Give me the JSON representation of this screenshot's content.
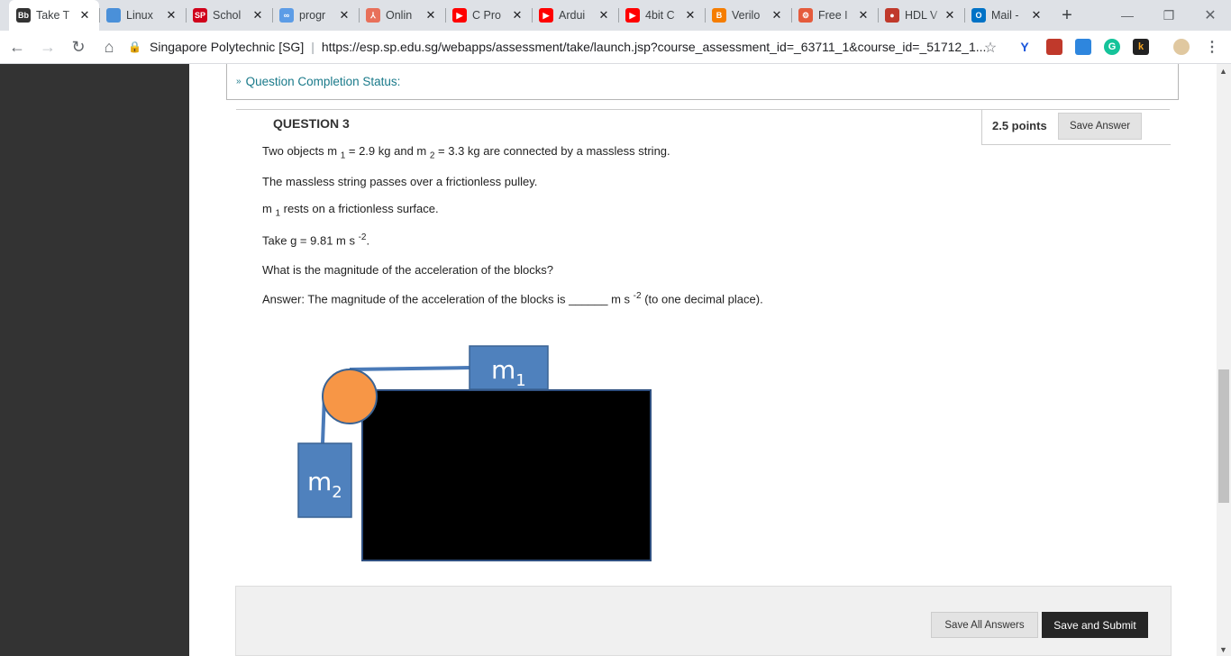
{
  "browser": {
    "tabs": [
      {
        "label": "Take T",
        "icon": "blackboard-icon",
        "color": "#333333",
        "glyph": "Bb"
      },
      {
        "label": "Linux",
        "icon": "doc-icon",
        "color": "#4a90d9",
        "glyph": ""
      },
      {
        "label": "Schol",
        "icon": "sp-icon",
        "color": "#d0021b",
        "glyph": "SP"
      },
      {
        "label": "progr",
        "icon": "repl-icon",
        "color": "#5c9ce6",
        "glyph": "∞"
      },
      {
        "label": "Onlin",
        "icon": "online-icon",
        "color": "#e8705a",
        "glyph": "⅄"
      },
      {
        "label": "C Pro",
        "icon": "youtube-icon",
        "color": "#ff0000",
        "glyph": "▶"
      },
      {
        "label": "Ardui",
        "icon": "youtube-icon",
        "color": "#ff0000",
        "glyph": "▶"
      },
      {
        "label": "4bit C",
        "icon": "youtube-icon",
        "color": "#ff0000",
        "glyph": "▶"
      },
      {
        "label": "Verilo",
        "icon": "blogger-icon",
        "color": "#f57d00",
        "glyph": "B"
      },
      {
        "label": "Free I",
        "icon": "gear-icon",
        "color": "#e55b3c",
        "glyph": "⚙"
      },
      {
        "label": "HDL V",
        "icon": "hdl-icon",
        "color": "#c0392b",
        "glyph": "●"
      },
      {
        "label": "Mail -",
        "icon": "outlook-icon",
        "color": "#0072c6",
        "glyph": "O"
      }
    ],
    "new_tab": "+",
    "minimize": "—",
    "restore": "❐",
    "close": "✕",
    "site_name": "Singapore Polytechnic [SG]",
    "url": "https://esp.sp.edu.sg/webapps/assessment/take/launch.jsp?course_assessment_id=_63711_1&course_id=_51712_1..."
  },
  "page": {
    "completion_status": "Question Completion Status:",
    "question_title": "QUESTION 3",
    "points": "2.5 points",
    "save_answer": "Save Answer",
    "line1": {
      "a": "Two objects m ",
      "sub1": "1",
      "b": " = 2.9 kg and m ",
      "sub2": "2",
      "c": " = 3.3 kg are connected by a massless string."
    },
    "line2": "The massless string passes over a frictionless pulley.",
    "line3": {
      "a": "m ",
      "sub": "1",
      "b": " rests on a frictionless surface."
    },
    "line4": {
      "a": "Take g = 9.81 m s ",
      "sup": "-2",
      "b": "."
    },
    "line5": "What is the magnitude of the acceleration of the blocks?",
    "line6": {
      "a": "Answer: The magnitude of the acceleration of the blocks is ______ m s ",
      "sup": "-2",
      "b": " (to one decimal place)."
    },
    "diagram": {
      "m1": "m",
      "m1_sub": "1",
      "m2": "m",
      "m2_sub": "2"
    },
    "save_all": "Save All Answers",
    "save_submit": "Save and Submit"
  }
}
